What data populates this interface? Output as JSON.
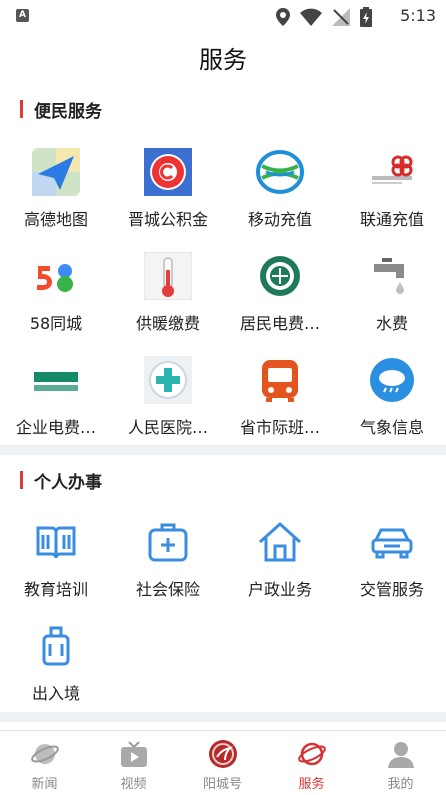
{
  "status_bar": {
    "time": "5:13",
    "badge": "A"
  },
  "page": {
    "title": "服务"
  },
  "sections": [
    {
      "title": "便民服务",
      "items": [
        {
          "label": "高德地图",
          "icon": "amap-icon"
        },
        {
          "label": "晋城公积金",
          "icon": "housing-fund-icon"
        },
        {
          "label": "移动充值",
          "icon": "china-mobile-icon"
        },
        {
          "label": "联通充值",
          "icon": "china-unicom-icon"
        },
        {
          "label": "58同城",
          "icon": "58-icon"
        },
        {
          "label": "供暖缴费",
          "icon": "thermometer-icon"
        },
        {
          "label": "居民电费…",
          "icon": "power-grid-seal-icon"
        },
        {
          "label": "水费",
          "icon": "faucet-icon"
        },
        {
          "label": "企业电费…",
          "icon": "state-grid-icon"
        },
        {
          "label": "人民医院…",
          "icon": "hospital-cross-icon"
        },
        {
          "label": "省市际班…",
          "icon": "bus-icon"
        },
        {
          "label": "气象信息",
          "icon": "weather-icon"
        }
      ]
    },
    {
      "title": "个人办事",
      "items": [
        {
          "label": "教育培训",
          "icon": "book-icon"
        },
        {
          "label": "社会保险",
          "icon": "medical-kit-icon"
        },
        {
          "label": "户政业务",
          "icon": "house-icon"
        },
        {
          "label": "交管服务",
          "icon": "car-icon"
        },
        {
          "label": "出入境",
          "icon": "luggage-icon"
        }
      ]
    }
  ],
  "tabs": [
    {
      "label": "新闻",
      "icon": "news-planet-icon",
      "active": false
    },
    {
      "label": "视频",
      "icon": "video-tv-icon",
      "active": false
    },
    {
      "label": "阳城号",
      "icon": "yangcheng-logo-icon",
      "active": false
    },
    {
      "label": "服务",
      "icon": "service-planet-icon",
      "active": true
    },
    {
      "label": "我的",
      "icon": "profile-icon",
      "active": false
    }
  ],
  "colors": {
    "accent": "#d33333",
    "section_bar": "#e03a3a",
    "icon_blue": "#3a8ee0",
    "divider": "#eef2f7"
  }
}
